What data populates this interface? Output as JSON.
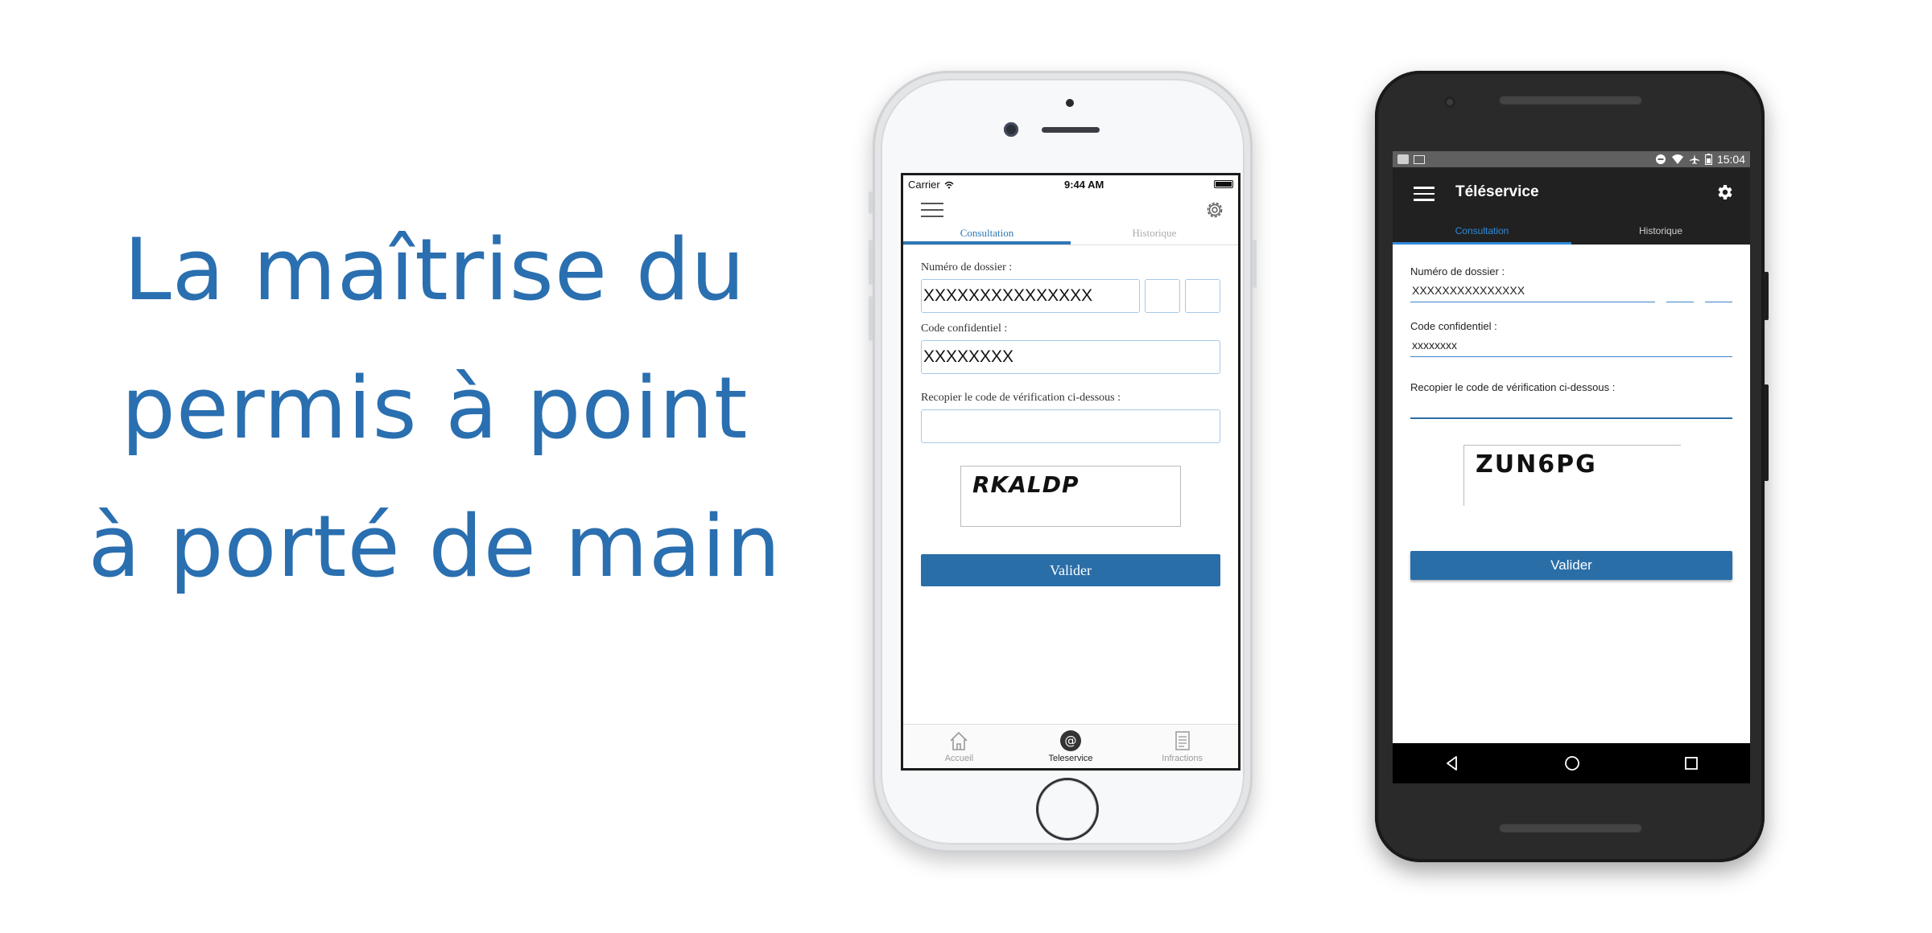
{
  "tagline": {
    "line1": "La maîtrise du",
    "line2": "permis à point",
    "line3": "à porté de main"
  },
  "iphone": {
    "status": {
      "carrier": "Carrier",
      "time": "9:44 AM"
    },
    "tabs": [
      {
        "label": "Consultation",
        "active": true
      },
      {
        "label": "Historique",
        "active": false
      }
    ],
    "form": {
      "dossier_label": "Numéro de dossier :",
      "dossier_value": "XXXXXXXXXXXXXXX",
      "code_label": "Code confidentiel :",
      "code_value": "XXXXXXXX",
      "verif_label": "Recopier le code de vérification ci-dessous :",
      "verif_value": "",
      "captcha": "RKALDP",
      "submit_label": "Valider"
    },
    "tabbar": [
      {
        "label": "Accueil",
        "icon": "home-icon",
        "active": false
      },
      {
        "label": "Teleservice",
        "icon": "at-icon",
        "active": true
      },
      {
        "label": "Infractions",
        "icon": "document-icon",
        "active": false
      }
    ]
  },
  "android": {
    "status": {
      "time": "15:04"
    },
    "appbar_title": "Téléservice",
    "tabs": [
      {
        "label": "Consultation",
        "active": true
      },
      {
        "label": "Historique",
        "active": false
      }
    ],
    "form": {
      "dossier_label": "Numéro de dossier :",
      "dossier_value": "XXXXXXXXXXXXXXX",
      "code_label": "Code confidentiel :",
      "code_value": "xxxxxxxx",
      "verif_label": "Recopier le code de vérification ci-dessous :",
      "verif_value": "",
      "captcha": "ZUN6PG",
      "submit_label": "Valider"
    }
  },
  "colors": {
    "accent": "#2a6fb0",
    "button": "#2a6ea8",
    "android_bar": "#212121"
  }
}
